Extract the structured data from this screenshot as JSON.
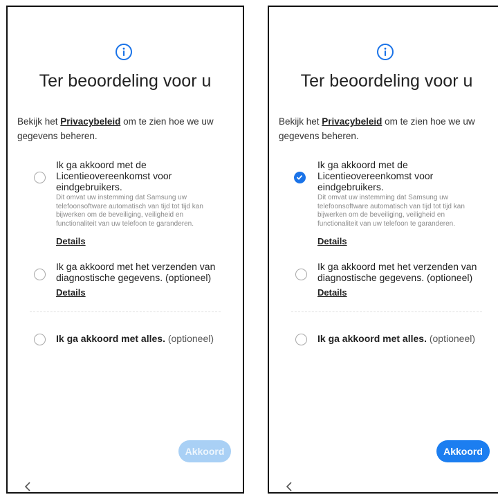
{
  "screens": [
    {
      "title": "Ter beoordeling voor u",
      "intro": {
        "prefix": "Bekijk het ",
        "link": "Privacybeleid",
        "suffix": " om te zien hoe we uw gegevens beheren."
      },
      "license": {
        "title_line1": "Ik ga akkoord met de",
        "title_line2": "Licentieovereenkomst voor",
        "title_line3": "eindgebruikers.",
        "description": "Dit omvat uw instemming dat Samsung uw telefoonsoftware automatisch van tijd tot tijd kan bijwerken om de beveiliging, veiligheid en functionaliteit van uw telefoon te garanderen.",
        "details": "Details",
        "checked": false
      },
      "diagnostics": {
        "title": "Ik ga akkoord met het verzenden van diagnostische gegevens. (optioneel)",
        "details": "Details",
        "checked": false
      },
      "all": {
        "bold": "Ik ga akkoord met alles.",
        "optional": " (optioneel)",
        "checked": false
      },
      "button": {
        "label": "Akkoord",
        "enabled": false
      }
    },
    {
      "title": "Ter beoordeling voor u",
      "intro": {
        "prefix": "Bekijk het ",
        "link": "Privacybeleid",
        "suffix": " om te zien hoe we uw gegevens beheren."
      },
      "license": {
        "title_line1": "Ik ga akkoord met de",
        "title_line2": "Licentieovereenkomst voor",
        "title_line3": "eindgebruikers.",
        "description": "Dit omvat uw instemming dat Samsung uw telefoonsoftware automatisch van tijd tot tijd kan bijwerken om de beveiliging, veiligheid en functionaliteit van uw telefoon te garanderen.",
        "details": "Details",
        "checked": true
      },
      "diagnostics": {
        "title": "Ik ga akkoord met het verzenden van diagnostische gegevens. (optioneel)",
        "details": "Details",
        "checked": false
      },
      "all": {
        "bold": "Ik ga akkoord met alles.",
        "optional": " (optioneel)",
        "checked": false
      },
      "button": {
        "label": "Akkoord",
        "enabled": true
      }
    }
  ],
  "icons": {
    "info": "info-icon",
    "back": "back-chevron-icon",
    "check": "checkmark-icon"
  },
  "colors": {
    "accent": "#1c7ef0",
    "accent_disabled": "#a9d0f5",
    "info_icon": "#1a73e8"
  }
}
